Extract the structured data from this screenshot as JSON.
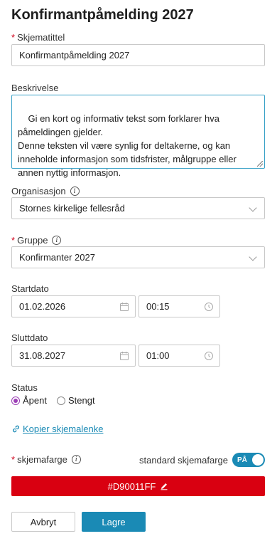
{
  "page_title": "Konfirmantpåmelding 2027",
  "form_title": {
    "label": "Skjematittel",
    "value": "Konfirmantpåmelding 2027",
    "required": "*"
  },
  "description": {
    "label": "Beskrivelse",
    "value": "Gi en kort og informativ tekst som forklarer hva påmeldingen gjelder.\nDenne teksten vil være synlig for deltakerne, og kan inneholde informasjon som tidsfrister, målgruppe eller annen nyttig informasjon."
  },
  "organisation": {
    "label": "Organisasjon",
    "value": "Stornes kirkelige fellesråd",
    "info": "i"
  },
  "group": {
    "label": "Gruppe",
    "value": "Konfirmanter 2027",
    "required": "*",
    "info": "i"
  },
  "start": {
    "label": "Startdato",
    "date": "01.02.2026",
    "time": "00:15"
  },
  "end": {
    "label": "Sluttdato",
    "date": "31.08.2027",
    "time": "01:00"
  },
  "status": {
    "label": "Status",
    "options": [
      "Åpent",
      "Stengt"
    ],
    "selected": "Åpent"
  },
  "copy_link": {
    "label": "Kopier skjemalenke"
  },
  "color": {
    "label": "skjemafarge",
    "required": "*",
    "info": "i",
    "default_label": "standard skjemafarge",
    "toggle_label": "PÅ",
    "value": "#D90011FF",
    "swatch": "#d90011"
  },
  "actions": {
    "cancel": "Avbryt",
    "save": "Lagre"
  },
  "colors": {
    "accent": "#1a8ab5",
    "required": "#d0021b",
    "radio": "#9b3fb5"
  }
}
